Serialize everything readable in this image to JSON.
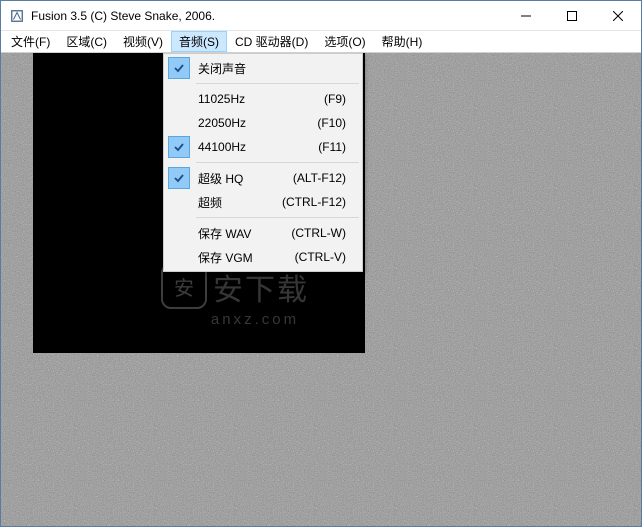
{
  "window": {
    "title": "Fusion 3.5 (C) Steve Snake, 2006."
  },
  "menubar": {
    "items": [
      {
        "label": "文件(F)"
      },
      {
        "label": "区域(C)"
      },
      {
        "label": "视频(V)"
      },
      {
        "label": "音频(S)",
        "active": true
      },
      {
        "label": "CD 驱动器(D)"
      },
      {
        "label": "选项(O)"
      },
      {
        "label": "帮助(H)"
      }
    ]
  },
  "dropdown": {
    "items": [
      {
        "label": "关闭声音",
        "shortcut": "",
        "checked": true
      },
      {
        "sep": true
      },
      {
        "label": "11025Hz",
        "shortcut": "(F9)",
        "checked": false
      },
      {
        "label": "22050Hz",
        "shortcut": "(F10)",
        "checked": false
      },
      {
        "label": "44100Hz",
        "shortcut": "(F11)",
        "checked": true
      },
      {
        "sep": true
      },
      {
        "label": "超级 HQ",
        "shortcut": "(ALT-F12)",
        "checked": true
      },
      {
        "label": "超频",
        "shortcut": "(CTRL-F12)",
        "checked": false
      },
      {
        "sep": true
      },
      {
        "label": "保存 WAV",
        "shortcut": "(CTRL-W)",
        "checked": false
      },
      {
        "label": "保存 VGM",
        "shortcut": "(CTRL-V)",
        "checked": false
      }
    ]
  },
  "watermark": {
    "logo_char": "安",
    "text": "安下载",
    "sub": "anxz.com"
  }
}
